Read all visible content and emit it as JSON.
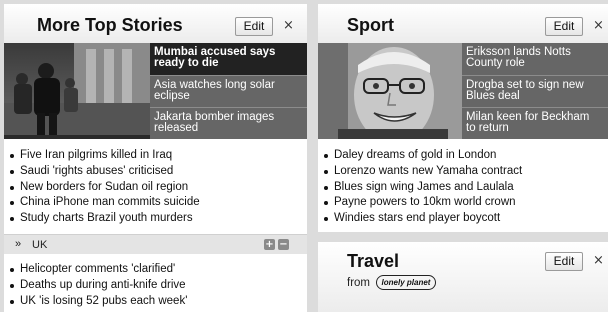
{
  "top_stories": {
    "title": "More Top Stories",
    "edit_label": "Edit",
    "close_glyph": "×",
    "photo_icon": "crowd-photo",
    "headlines": [
      {
        "text_l1": "Mumbai accused says",
        "text_l2": "ready to die",
        "active": true
      },
      {
        "text_l1": "Asia watches long solar",
        "text_l2": "eclipse",
        "active": false
      },
      {
        "text_l1": "Jakarta bomber images",
        "text_l2": "released",
        "active": false
      }
    ],
    "stories": [
      "Five Iran pilgrims killed in Iraq",
      "Saudi 'rights abuses' criticised",
      "New borders for Sudan oil region",
      "China iPhone man commits suicide",
      "Study charts Brazil youth murders"
    ]
  },
  "uk_section": {
    "chevron": "»",
    "label": "UK",
    "expand_glyph": "+",
    "collapse_glyph": "−",
    "stories": [
      "Helicopter comments 'clarified'",
      "Deaths up during anti-knife drive",
      "UK 'is losing 52 pubs each week'"
    ]
  },
  "sport": {
    "title": "Sport",
    "edit_label": "Edit",
    "close_glyph": "×",
    "photo_icon": "smiling-man-portrait",
    "headlines": [
      {
        "text_l1": "Eriksson lands Notts",
        "text_l2": "County role",
        "active": false
      },
      {
        "text_l1": "Drogba set to sign new",
        "text_l2": "Blues deal",
        "active": false
      },
      {
        "text_l1": "Milan keen for Beckham",
        "text_l2": "to return",
        "active": false
      }
    ],
    "stories": [
      "Daley dreams of gold in London",
      "Lorenzo wants new Yamaha contract",
      "Blues sign wing James and Laulala",
      "Payne powers to 10km world crown",
      "Windies stars end player boycott"
    ]
  },
  "travel": {
    "title": "Travel",
    "edit_label": "Edit",
    "close_glyph": "×",
    "from_label": "from",
    "logo_text": "lonely planet"
  }
}
